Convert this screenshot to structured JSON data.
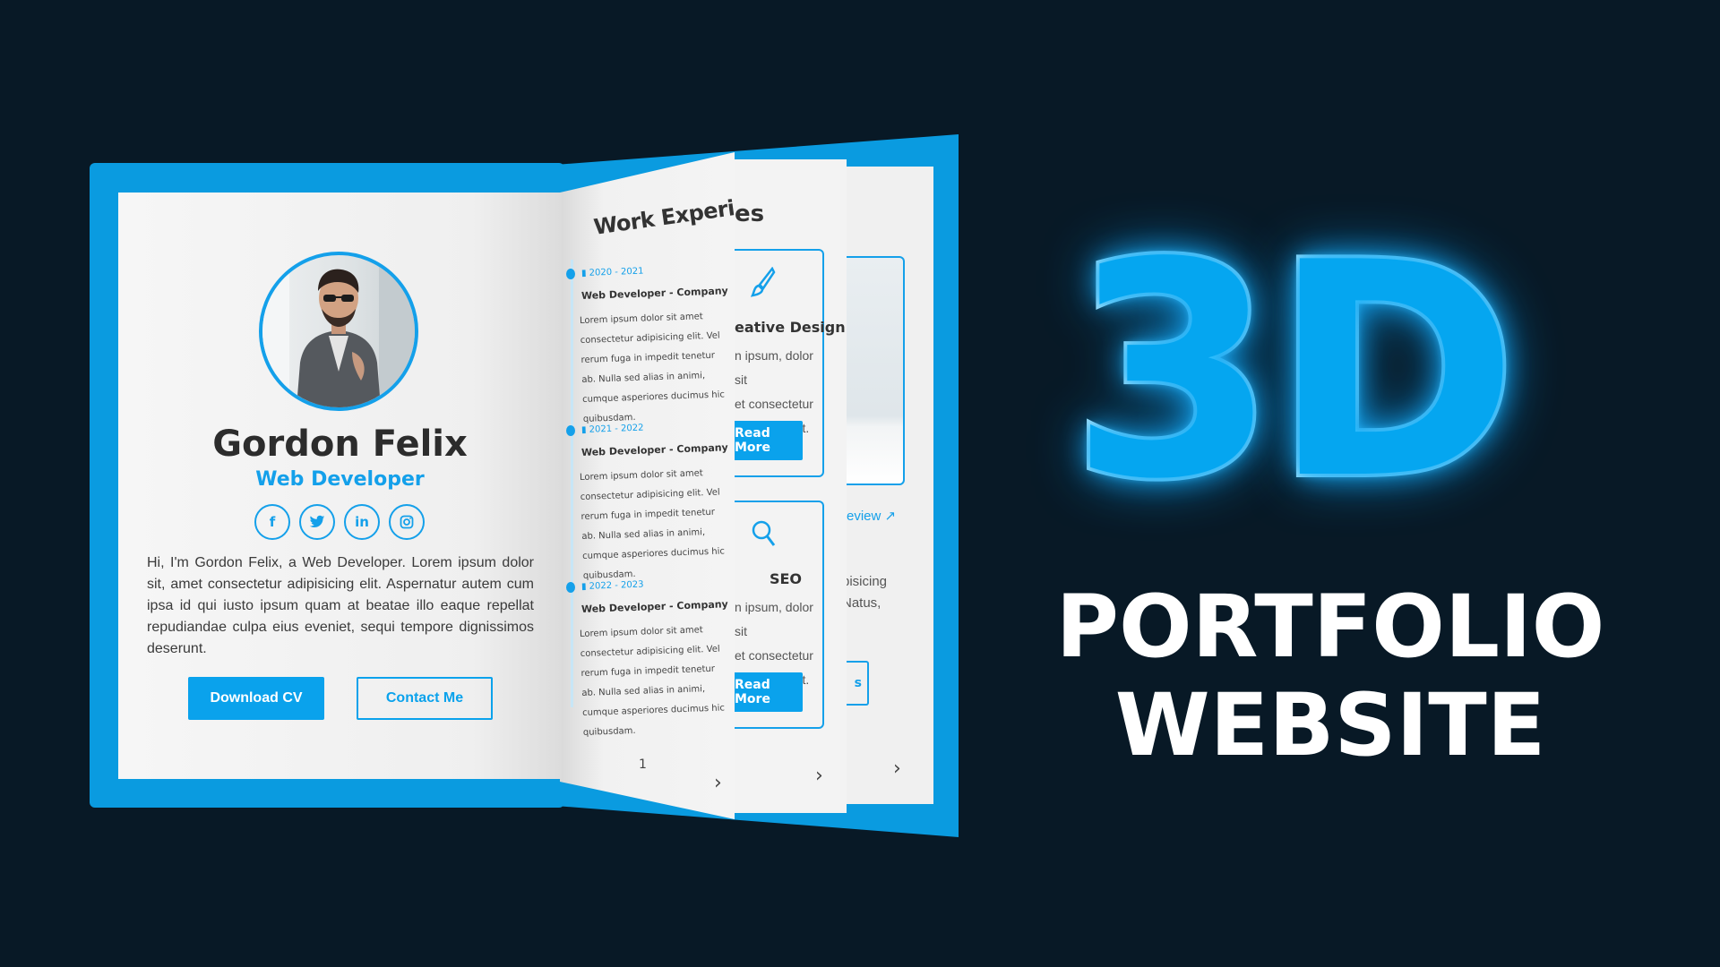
{
  "profile": {
    "name": "Gordon Felix",
    "role": "Web Developer",
    "bio": "Hi, I'm Gordon Felix, a Web Developer. Lorem ipsum dolor sit, amet consectetur adipisicing elit. Aspernatur autem cum ipsa id qui iusto ipsum quam at beatae illo eaque repellat repudiandae culpa eius eveniet, sequi tempore dignissimos deserunt.",
    "socials": [
      {
        "name": "facebook-icon",
        "glyph": "f"
      },
      {
        "name": "twitter-icon",
        "glyph": "t"
      },
      {
        "name": "linkedin-icon",
        "glyph": "in"
      },
      {
        "name": "instagram-icon",
        "glyph": "◎"
      }
    ],
    "download_cv_label": "Download CV",
    "contact_label": "Contact Me"
  },
  "experience": {
    "heading": "Work Experience",
    "items": [
      {
        "date": "2020 - 2021",
        "title": "Web Developer - Company",
        "body": "Lorem ipsum dolor sit amet consectetur adipisicing elit. Vel rerum fuga in impedit tenetur ab. Nulla sed alias in animi, cumque asperiores ducimus hic quibusdam."
      },
      {
        "date": "2021 - 2022",
        "title": "Web Developer - Company",
        "body": "Lorem ipsum dolor sit amet consectetur adipisicing elit. Vel rerum fuga in impedit tenetur ab. Nulla sed alias in animi, cumque asperiores ducimus hic quibusdam."
      },
      {
        "date": "2022 - 2023",
        "title": "Web Developer - Company",
        "body": "Lorem ipsum dolor sit amet consectetur adipisicing elit. Vel rerum fuga in impedit tenetur ab. Nulla sed alias in animi, cumque asperiores ducimus hic quibusdam."
      }
    ],
    "page_marker": "1",
    "next_glyph": "›"
  },
  "services": {
    "heading_fragment": "es",
    "cards": [
      {
        "icon": "paintbrush-icon",
        "title": "eative Design",
        "text": "n ipsum, dolor sit\net consectetur\ndipisicing elit.",
        "button": "Read More"
      },
      {
        "icon": "search-icon",
        "title": "SEO",
        "text": "n ipsum, dolor sit\net consectetur\ndipisicing elit.",
        "button": "Read More"
      }
    ],
    "next_glyph": "›"
  },
  "projects": {
    "preview_label": "review",
    "text": "bisicing\nNatus,",
    "button_fragment": "s",
    "next_glyph": "›"
  },
  "headline": {
    "big": "3D",
    "line1": "PORTFOLIO",
    "line2": "WEBSITE"
  },
  "colors": {
    "background": "#081926",
    "accent": "#0aa2ec",
    "book": "#0a9be0",
    "glow": "#31c2ff"
  }
}
